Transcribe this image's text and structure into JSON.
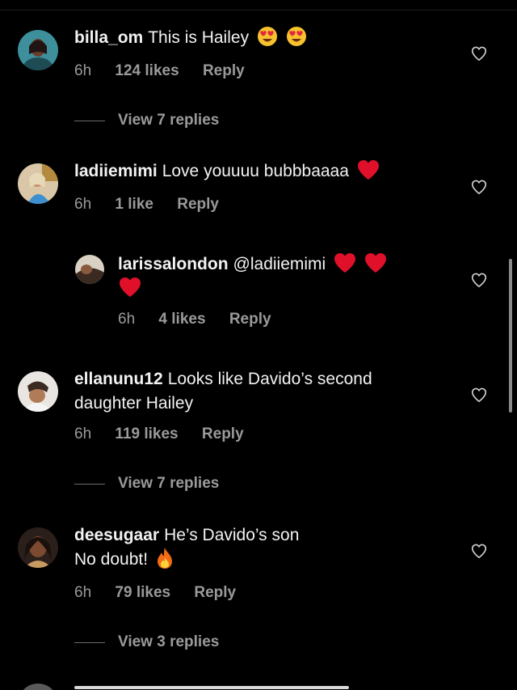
{
  "comments": [
    {
      "username": "billa_om",
      "text": "This is Hailey",
      "emoji": [
        "heart-eyes",
        "heart-eyes"
      ],
      "time": "6h",
      "likes": "124 likes",
      "reply": "Reply",
      "view_replies": "View 7 replies"
    },
    {
      "username": "ladiiemimi",
      "text": "Love youuuu bubbbaaaa",
      "emoji": [
        "red-heart"
      ],
      "time": "6h",
      "likes": "1 like",
      "reply": "Reply"
    },
    {
      "username": "larissalondon",
      "text": "@ladiiemimi",
      "emoji": [
        "red-heart",
        "red-heart",
        "red-heart"
      ],
      "time": "6h",
      "likes": "4 likes",
      "reply": "Reply"
    },
    {
      "username": "ellanunu12",
      "text_line1": "Looks like Davido’s second",
      "text_line2": "daughter Hailey",
      "time": "6h",
      "likes": "119 likes",
      "reply": "Reply",
      "view_replies": "View 7 replies"
    },
    {
      "username": "deesugaar",
      "text_line1": "He’s Davido’s son",
      "text_line2": "No doubt!",
      "emoji": [
        "fire"
      ],
      "time": "6h",
      "likes": "79 likes",
      "reply": "Reply",
      "view_replies": "View 3 replies"
    }
  ],
  "icons": {
    "like": "heart-outline-icon"
  },
  "colors": {
    "background": "#000000",
    "text": "#f2f2f2",
    "muted": "#9a9a9a",
    "heart": "#e0102b"
  }
}
